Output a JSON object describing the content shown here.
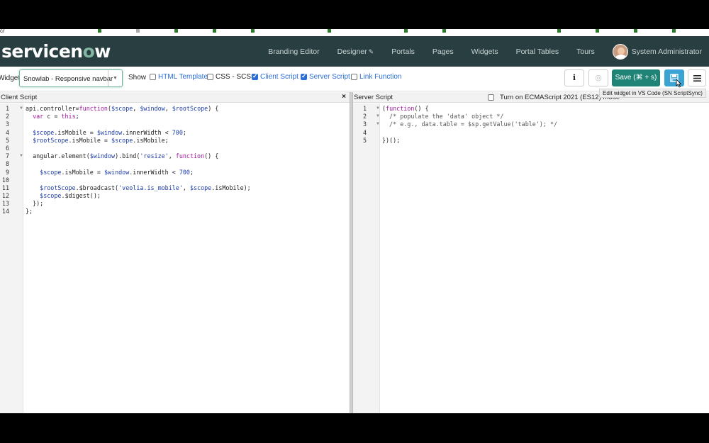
{
  "header": {
    "logo": "servicenow",
    "nav": [
      "Branding Editor",
      "Designer",
      "Portals",
      "Pages",
      "Widgets",
      "Portal Tables",
      "Tours"
    ],
    "user_name": "System Administrator"
  },
  "toolbar": {
    "widget_label": "Widget",
    "widget_selected": "Snowlab - Responsive navbar",
    "show_label": "Show",
    "checkboxes": [
      {
        "label": "HTML Template",
        "checked": false
      },
      {
        "label": "CSS - SCSS",
        "checked": false
      },
      {
        "label": "Client Script",
        "checked": true
      },
      {
        "label": "Server Script",
        "checked": true
      },
      {
        "label": "Link Function",
        "checked": false
      }
    ],
    "info_label": "i",
    "save_label": "Save (⌘ + s)",
    "tooltip": "Edit widget in VS Code (SN ScriptSync)"
  },
  "left_pane": {
    "title": "Client Script",
    "close": "×",
    "line_numbers": [
      "1",
      "2",
      "3",
      "4",
      "5",
      "6",
      "7",
      "8",
      "9",
      "10",
      "11",
      "12",
      "13",
      "14"
    ]
  },
  "right_pane": {
    "title": "Server Script",
    "ecma_label": "Turn on ECMAScript 2021 (ES12) mode",
    "line_numbers": [
      "1",
      "2",
      "3",
      "4",
      "5"
    ]
  },
  "colors": {
    "header_bg": "#293e40",
    "save_bg": "#1f8476",
    "sync_bg": "#3aa3d3",
    "link_blue": "#2b6fd6"
  }
}
